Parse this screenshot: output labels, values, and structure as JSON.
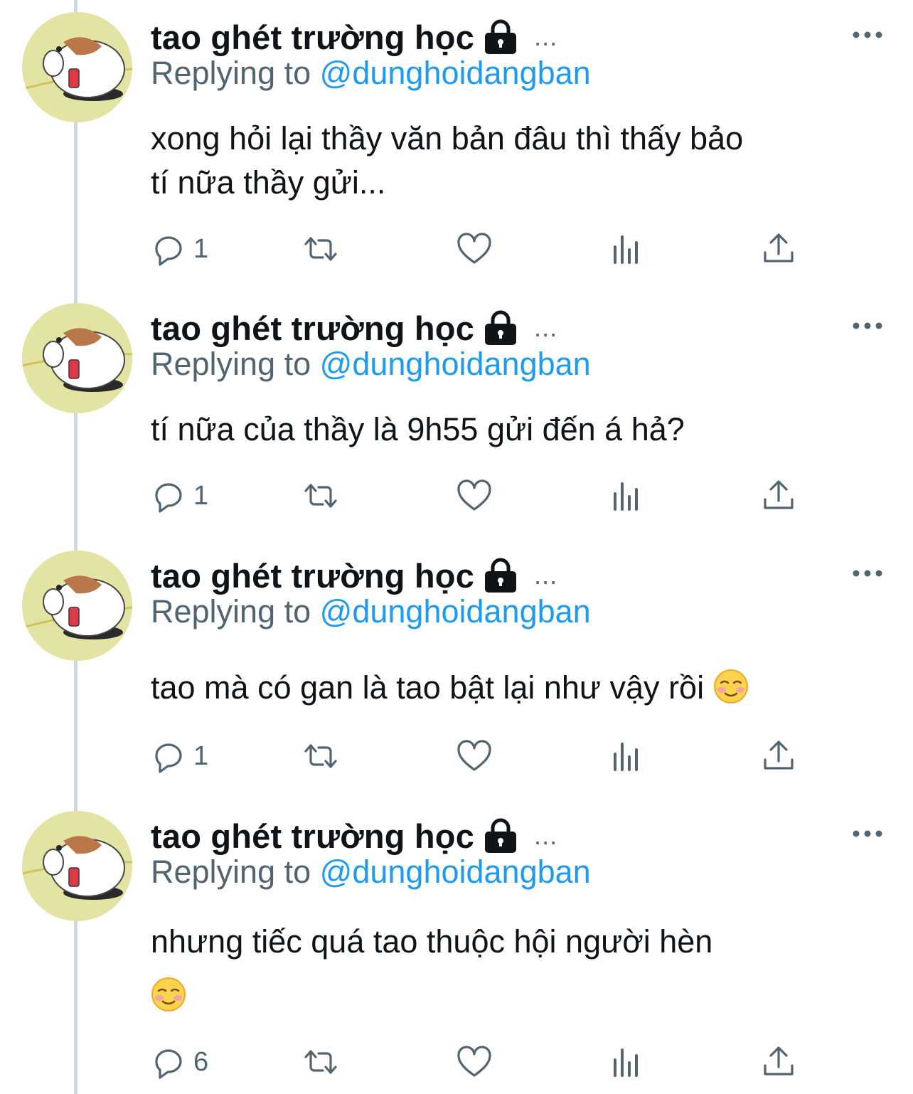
{
  "thread": {
    "tweets": [
      {
        "name": "tao ghét trường học",
        "more": "...",
        "reply_prefix": "Replying to",
        "reply_handle": "@dunghoidangban",
        "text_lines": [
          "xong hỏi lại thầy văn bản đâu thì thấy bảo",
          "tí nữa thầy gửi..."
        ],
        "reply_count": "1"
      },
      {
        "name": "tao ghét trường học",
        "more": "...",
        "reply_prefix": "Replying to",
        "reply_handle": "@dunghoidangban",
        "text_lines": [
          "tí nữa của thầy là 9h55 gửi đến á hả?"
        ],
        "reply_count": "1"
      },
      {
        "name": "tao ghét trường học",
        "more": "...",
        "reply_prefix": "Replying to",
        "reply_handle": "@dunghoidangban",
        "text_lines": [
          "tao mà có gan là tao bật lại như vậy rồi"
        ],
        "emoji": "smiling-face-emoji",
        "reply_count": "1"
      },
      {
        "name": "tao ghét trường học",
        "more": "...",
        "reply_prefix": "Replying to",
        "reply_handle": "@dunghoidangban",
        "text_lines": [
          "nhưng tiếc quá tao thuộc hội người hèn"
        ],
        "emoji": "smiling-face-emoji",
        "reply_count": "6"
      }
    ]
  },
  "icons": {
    "avatar": "hamster-avatar",
    "lock": "lock-icon",
    "menu": "more-options-icon",
    "reply": "reply-icon",
    "retweet": "retweet-icon",
    "like": "heart-icon",
    "views": "analytics-icon",
    "share": "share-icon"
  },
  "colors": {
    "text": "#0f1419",
    "secondary": "#536471",
    "link": "#1d9bf0",
    "thread_line": "#cfd9de",
    "avatar_bg": "#e3e4a3"
  }
}
